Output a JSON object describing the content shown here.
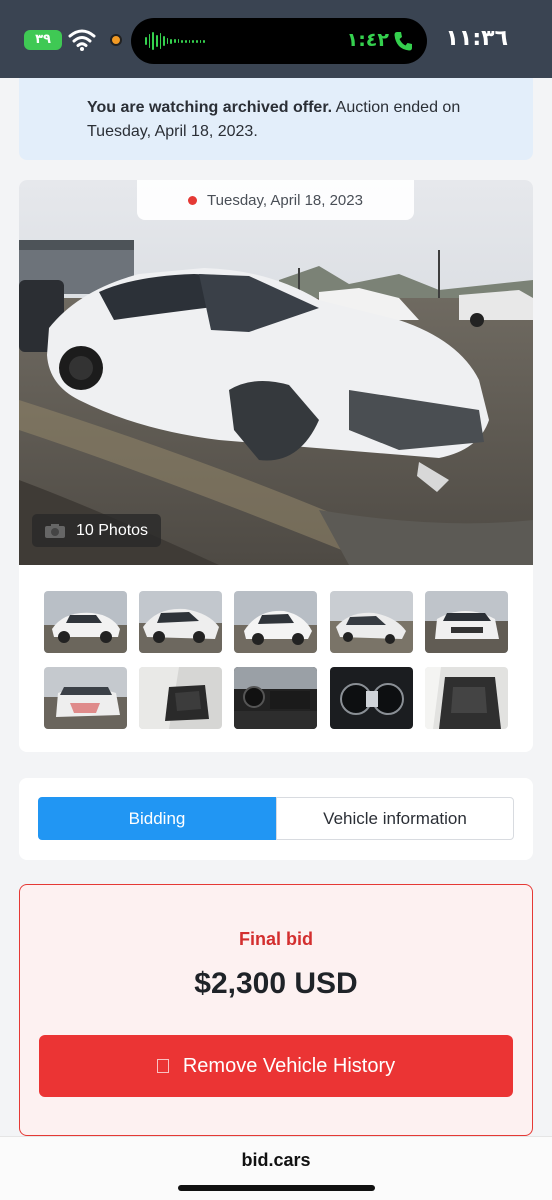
{
  "status_bar": {
    "battery": "٣٩",
    "island_time": "١:٤٢",
    "clock": "١١:٣٦",
    "icons": [
      "battery-charging-icon",
      "wifi-icon",
      "camera-indicator-icon",
      "audio-wave-icon",
      "phone-icon"
    ]
  },
  "notice": {
    "bold": "You are watching archived offer.",
    "text": " Auction ended on Tuesday, April 18, 2023."
  },
  "gallery": {
    "date": "Tuesday, April 18, 2023",
    "photos_label": "10 Photos",
    "thumbnail_count": 10
  },
  "tabs": [
    {
      "label": "Bidding",
      "active": true
    },
    {
      "label": "Vehicle information",
      "active": false
    }
  ],
  "bid": {
    "label": "Final bid",
    "amount": "$2,300 USD",
    "button": "Remove Vehicle History"
  },
  "browser": {
    "url": "bid.cars"
  },
  "colors": {
    "status_bg": "#3a4452",
    "accent_blue": "#2196f3",
    "bid_red": "#d32f2f",
    "button_red": "#eb3434",
    "notice_bg": "#e3eefa"
  }
}
